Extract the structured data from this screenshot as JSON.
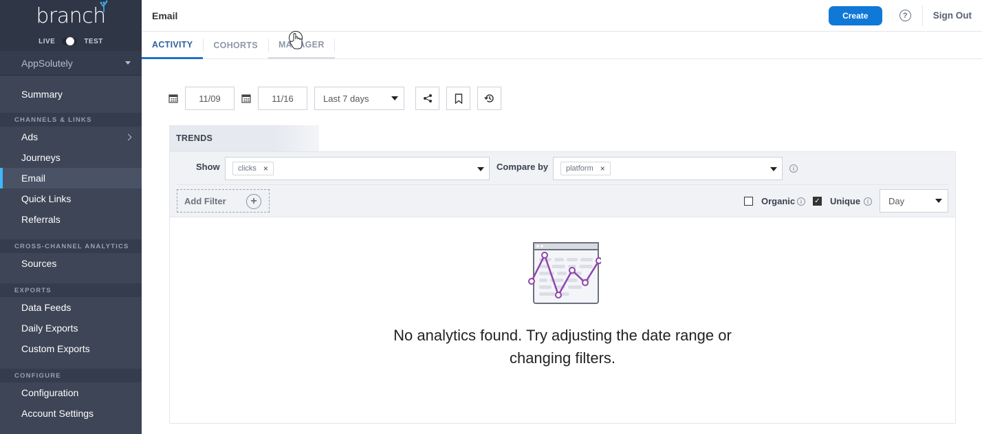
{
  "brand": {
    "logo_text": "branch"
  },
  "environment": {
    "live_label": "LIVE",
    "test_label": "TEST"
  },
  "app_selector": {
    "value": "AppSolutely"
  },
  "sidebar": {
    "summary": "Summary",
    "sections": [
      {
        "title": "CHANNELS & LINKS",
        "items": [
          "Ads",
          "Journeys",
          "Email",
          "Quick Links",
          "Referrals"
        ]
      },
      {
        "title": "CROSS-CHANNEL ANALYTICS",
        "items": [
          "Sources"
        ]
      },
      {
        "title": "EXPORTS",
        "items": [
          "Data Feeds",
          "Daily Exports",
          "Custom Exports"
        ]
      },
      {
        "title": "CONFIGURE",
        "items": [
          "Configuration",
          "Account Settings"
        ]
      }
    ],
    "active_item": "Email"
  },
  "header": {
    "title": "Email",
    "create_label": "Create",
    "help_icon": "question-circle-icon",
    "signout_label": "Sign Out"
  },
  "tabs": [
    {
      "label": "ACTIVITY",
      "state": "active"
    },
    {
      "label": "COHORTS",
      "state": "normal"
    },
    {
      "label": "MANAGER",
      "state": "hover"
    }
  ],
  "date_controls": {
    "start_date": "11/09",
    "end_date": "11/16",
    "range": "Last 7 days",
    "icons": [
      "share-icon",
      "bookmark-icon",
      "history-icon"
    ]
  },
  "trends": {
    "title": "TRENDS",
    "show_label": "Show",
    "show_chip": "clicks",
    "compare_label": "Compare by",
    "compare_chip": "platform",
    "add_filter_label": "Add Filter",
    "organic_label": "Organic",
    "organic_checked": false,
    "unique_label": "Unique",
    "unique_checked": true,
    "granularity": "Day",
    "empty_message": "No analytics found. Try adjusting the date range or changing filters."
  },
  "colors": {
    "sidebar_bg": "#3d4556",
    "accent": "#1078d6",
    "active_tab": "#1f72c9",
    "illustration_line": "#8e44ad"
  }
}
